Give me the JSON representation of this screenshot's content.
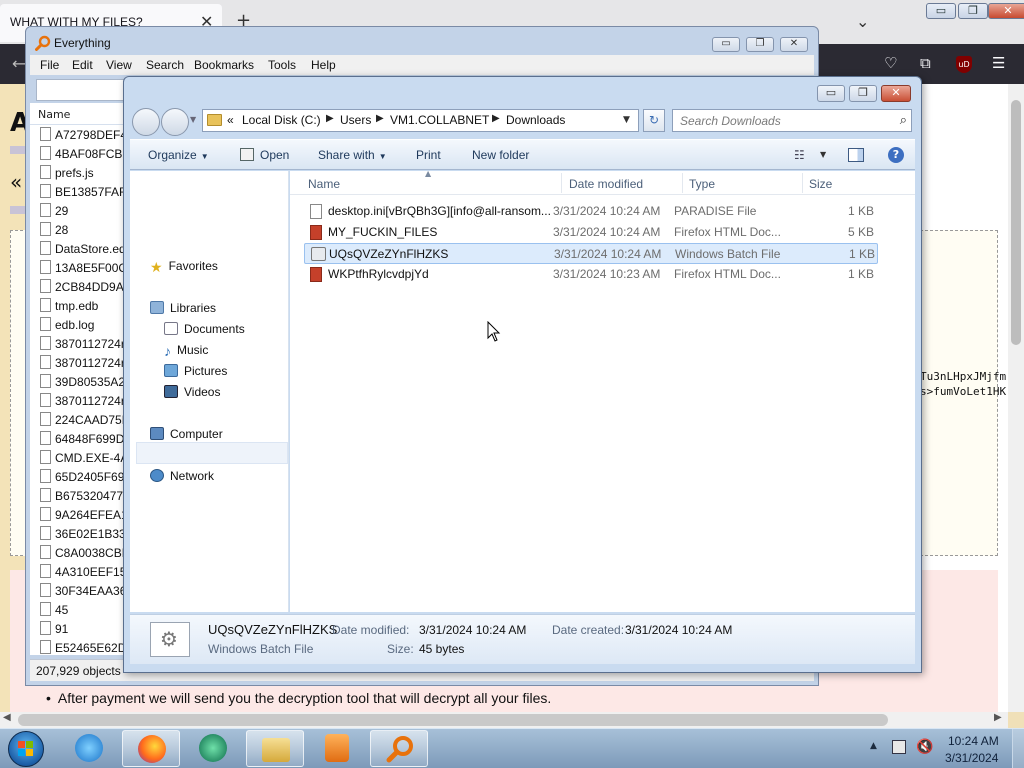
{
  "firefox": {
    "tab_title": "WHAT WITH MY FILES?",
    "tab_close": "✕",
    "new_tab": "+",
    "tab_list": "⌄",
    "caption": {
      "minimize": "▭",
      "restore": "❐",
      "close": "✕"
    },
    "back": "⟵",
    "toolbar_icons": {
      "pocket": "♡",
      "extensions": "⧉",
      "ublock": "uD",
      "menu": "☰"
    },
    "page": {
      "heading_fragment": "A",
      "nav_fragment": "«",
      "code_line_1": "Tu3nLHpxJMjfm",
      "code_line_2": "s>fumVoLet1HK",
      "bullet": "After payment we will send you the decryption tool that will decrypt all your files."
    },
    "scroll_left": "◀",
    "scroll_right": "▶"
  },
  "everything": {
    "title": "Everything",
    "caption": {
      "minimize": "▭",
      "maximize": "❐",
      "close": "✕"
    },
    "menu": [
      "File",
      "Edit",
      "View",
      "Search",
      "Bookmarks",
      "Tools",
      "Help"
    ],
    "column_name": "Name",
    "rows": [
      "A72798DEF4F",
      "4BAF08FCB2",
      "prefs.js",
      "BE13857FAF2",
      "29",
      "28",
      "DataStore.edb",
      "13A8E5F00CF",
      "2CB84DD9AE",
      "tmp.edb",
      "edb.log",
      "3870112724rs",
      "3870112724rs",
      "39D80535A21",
      "3870112724rs",
      "224CAAD75E",
      "64848F699D8",
      "CMD.EXE-4A",
      "65D2405F69A",
      "B6753204778",
      "9A264EFEA14",
      "36E02E1B332",
      "C8A0038CBF",
      "4A310EEF15E",
      "30F34EAA36E",
      "45",
      "91",
      "E52465E62D5"
    ],
    "status": "207,929 objects"
  },
  "explorer": {
    "caption": {
      "minimize": "▭",
      "maximize": "❐",
      "close": "✕"
    },
    "breadcrumb": [
      "«",
      "Local Disk (C:)",
      "Users",
      "VM1.COLLABNET",
      "Downloads"
    ],
    "breadcrumb_sep": "▶",
    "refresh": "↻",
    "search_placeholder": "Search Downloads",
    "search_icon": "⌕",
    "toolbar": {
      "organize": "Organize",
      "open": "Open",
      "share_with": "Share with",
      "print": "Print",
      "new_folder": "New folder",
      "dropdown": "▼",
      "view": "☷",
      "help": "?"
    },
    "nav": {
      "favorites": "Favorites",
      "libraries": "Libraries",
      "documents": "Documents",
      "music": "Music",
      "pictures": "Pictures",
      "videos": "Videos",
      "computer": "Computer",
      "network": "Network"
    },
    "columns": {
      "name": "Name",
      "date": "Date modified",
      "type": "Type",
      "size": "Size"
    },
    "sort_arrow": "▲",
    "files": [
      {
        "name": "desktop.ini[vBrQBh3G][info@all-ransom...",
        "date": "3/31/2024 10:24 AM",
        "type": "PARADISE File",
        "size": "1 KB",
        "icon": "file",
        "selected": false
      },
      {
        "name": "MY_FUCKIN_FILES",
        "date": "3/31/2024 10:24 AM",
        "type": "Firefox HTML Doc...",
        "size": "5 KB",
        "icon": "firefox",
        "selected": false
      },
      {
        "name": "UQsQVZeZYnFlHZKS",
        "date": "3/31/2024 10:24 AM",
        "type": "Windows Batch File",
        "size": "1 KB",
        "icon": "batch",
        "selected": true
      },
      {
        "name": "WKPtfhRylcvdpjYd",
        "date": "3/31/2024 10:23 AM",
        "type": "Firefox HTML Doc...",
        "size": "1 KB",
        "icon": "firefox",
        "selected": false
      }
    ],
    "details": {
      "name": "UQsQVZeZYnFlHZKS",
      "type": "Windows Batch File",
      "modified_label": "Date modified:",
      "modified_value": "3/31/2024 10:24 AM",
      "created_label": "Date created:",
      "created_value": "3/31/2024 10:24 AM",
      "size_label": "Size:",
      "size_value": "45 bytes"
    }
  },
  "taskbar": {
    "apps": [
      "internet-explorer",
      "firefox",
      "media-center",
      "windows-explorer",
      "media-player",
      "everything-search"
    ],
    "tray_up": "▲",
    "volume": "🔇",
    "clock_time": "10:24 AM",
    "clock_date": "3/31/2024"
  },
  "colors": {
    "selection": "#dcebfc",
    "explorer_frame": "#c9dbf0",
    "taskbar": "#8fa9c6",
    "firefox_nav": "#2b2a33"
  }
}
